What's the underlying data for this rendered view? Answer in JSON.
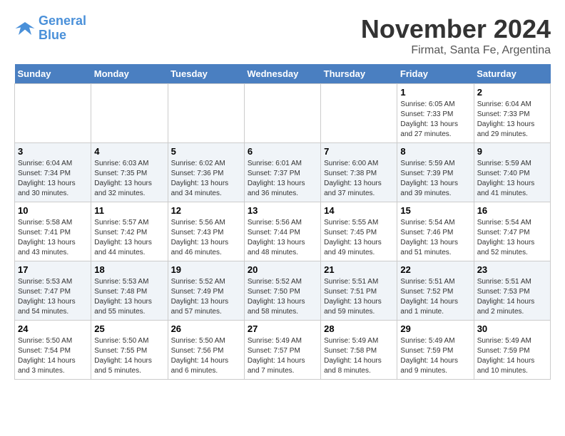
{
  "logo": {
    "line1": "General",
    "line2": "Blue"
  },
  "title": "November 2024",
  "location": "Firmat, Santa Fe, Argentina",
  "days_of_week": [
    "Sunday",
    "Monday",
    "Tuesday",
    "Wednesday",
    "Thursday",
    "Friday",
    "Saturday"
  ],
  "weeks": [
    [
      {
        "day": "",
        "info": ""
      },
      {
        "day": "",
        "info": ""
      },
      {
        "day": "",
        "info": ""
      },
      {
        "day": "",
        "info": ""
      },
      {
        "day": "",
        "info": ""
      },
      {
        "day": "1",
        "info": "Sunrise: 6:05 AM\nSunset: 7:33 PM\nDaylight: 13 hours\nand 27 minutes."
      },
      {
        "day": "2",
        "info": "Sunrise: 6:04 AM\nSunset: 7:33 PM\nDaylight: 13 hours\nand 29 minutes."
      }
    ],
    [
      {
        "day": "3",
        "info": "Sunrise: 6:04 AM\nSunset: 7:34 PM\nDaylight: 13 hours\nand 30 minutes."
      },
      {
        "day": "4",
        "info": "Sunrise: 6:03 AM\nSunset: 7:35 PM\nDaylight: 13 hours\nand 32 minutes."
      },
      {
        "day": "5",
        "info": "Sunrise: 6:02 AM\nSunset: 7:36 PM\nDaylight: 13 hours\nand 34 minutes."
      },
      {
        "day": "6",
        "info": "Sunrise: 6:01 AM\nSunset: 7:37 PM\nDaylight: 13 hours\nand 36 minutes."
      },
      {
        "day": "7",
        "info": "Sunrise: 6:00 AM\nSunset: 7:38 PM\nDaylight: 13 hours\nand 37 minutes."
      },
      {
        "day": "8",
        "info": "Sunrise: 5:59 AM\nSunset: 7:39 PM\nDaylight: 13 hours\nand 39 minutes."
      },
      {
        "day": "9",
        "info": "Sunrise: 5:59 AM\nSunset: 7:40 PM\nDaylight: 13 hours\nand 41 minutes."
      }
    ],
    [
      {
        "day": "10",
        "info": "Sunrise: 5:58 AM\nSunset: 7:41 PM\nDaylight: 13 hours\nand 43 minutes."
      },
      {
        "day": "11",
        "info": "Sunrise: 5:57 AM\nSunset: 7:42 PM\nDaylight: 13 hours\nand 44 minutes."
      },
      {
        "day": "12",
        "info": "Sunrise: 5:56 AM\nSunset: 7:43 PM\nDaylight: 13 hours\nand 46 minutes."
      },
      {
        "day": "13",
        "info": "Sunrise: 5:56 AM\nSunset: 7:44 PM\nDaylight: 13 hours\nand 48 minutes."
      },
      {
        "day": "14",
        "info": "Sunrise: 5:55 AM\nSunset: 7:45 PM\nDaylight: 13 hours\nand 49 minutes."
      },
      {
        "day": "15",
        "info": "Sunrise: 5:54 AM\nSunset: 7:46 PM\nDaylight: 13 hours\nand 51 minutes."
      },
      {
        "day": "16",
        "info": "Sunrise: 5:54 AM\nSunset: 7:47 PM\nDaylight: 13 hours\nand 52 minutes."
      }
    ],
    [
      {
        "day": "17",
        "info": "Sunrise: 5:53 AM\nSunset: 7:47 PM\nDaylight: 13 hours\nand 54 minutes."
      },
      {
        "day": "18",
        "info": "Sunrise: 5:53 AM\nSunset: 7:48 PM\nDaylight: 13 hours\nand 55 minutes."
      },
      {
        "day": "19",
        "info": "Sunrise: 5:52 AM\nSunset: 7:49 PM\nDaylight: 13 hours\nand 57 minutes."
      },
      {
        "day": "20",
        "info": "Sunrise: 5:52 AM\nSunset: 7:50 PM\nDaylight: 13 hours\nand 58 minutes."
      },
      {
        "day": "21",
        "info": "Sunrise: 5:51 AM\nSunset: 7:51 PM\nDaylight: 13 hours\nand 59 minutes."
      },
      {
        "day": "22",
        "info": "Sunrise: 5:51 AM\nSunset: 7:52 PM\nDaylight: 14 hours\nand 1 minute."
      },
      {
        "day": "23",
        "info": "Sunrise: 5:51 AM\nSunset: 7:53 PM\nDaylight: 14 hours\nand 2 minutes."
      }
    ],
    [
      {
        "day": "24",
        "info": "Sunrise: 5:50 AM\nSunset: 7:54 PM\nDaylight: 14 hours\nand 3 minutes."
      },
      {
        "day": "25",
        "info": "Sunrise: 5:50 AM\nSunset: 7:55 PM\nDaylight: 14 hours\nand 5 minutes."
      },
      {
        "day": "26",
        "info": "Sunrise: 5:50 AM\nSunset: 7:56 PM\nDaylight: 14 hours\nand 6 minutes."
      },
      {
        "day": "27",
        "info": "Sunrise: 5:49 AM\nSunset: 7:57 PM\nDaylight: 14 hours\nand 7 minutes."
      },
      {
        "day": "28",
        "info": "Sunrise: 5:49 AM\nSunset: 7:58 PM\nDaylight: 14 hours\nand 8 minutes."
      },
      {
        "day": "29",
        "info": "Sunrise: 5:49 AM\nSunset: 7:59 PM\nDaylight: 14 hours\nand 9 minutes."
      },
      {
        "day": "30",
        "info": "Sunrise: 5:49 AM\nSunset: 7:59 PM\nDaylight: 14 hours\nand 10 minutes."
      }
    ]
  ]
}
